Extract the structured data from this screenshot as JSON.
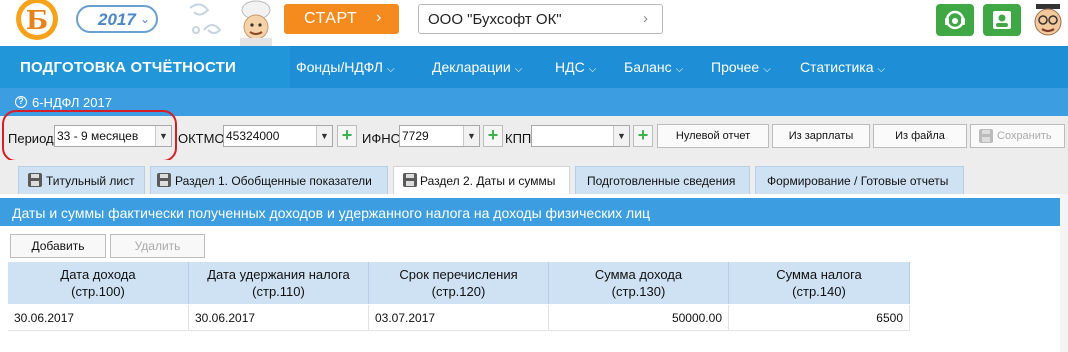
{
  "topbar": {
    "year": "2017",
    "start_label": "СТАРТ",
    "start_arrow": "›",
    "org_name": "ООО \"Бухсофт ОК\"",
    "org_arrow": "›",
    "accent_orange": "#f58a1f",
    "accent_green": "#3fa845"
  },
  "nav": {
    "title": "ПОДГОТОВКА ОТЧЁТНОСТИ",
    "items": [
      {
        "label": "Фонды/НДФЛ"
      },
      {
        "label": "Декларации"
      },
      {
        "label": "НДС"
      },
      {
        "label": "Баланс"
      },
      {
        "label": "Прочее"
      },
      {
        "label": "Статистика"
      }
    ],
    "color": "#1e8fd6"
  },
  "report": {
    "title": "6-НДФЛ 2017"
  },
  "toolbar": {
    "period_label": "Период",
    "period_value": "33 - 9 месяцев",
    "oktmo_label": "ОКТМО",
    "oktmo_value": "45324000",
    "ifns_label": "ИФНС",
    "ifns_value": "7729",
    "kpp_label": "КПП",
    "kpp_value": "",
    "zero_report": "Нулевой отчет",
    "from_salary": "Из зарплаты",
    "from_file": "Из файла",
    "save": "Сохранить"
  },
  "tabs": [
    {
      "label": "Титульный лист"
    },
    {
      "label": "Раздел 1. Обобщенные показатели"
    },
    {
      "label": "Раздел 2. Даты и суммы"
    },
    {
      "label": "Подготовленные сведения"
    },
    {
      "label": "Формирование / Готовые отчеты"
    }
  ],
  "section": {
    "title": "Даты и суммы фактически полученных доходов и удержанного налога на доходы физических лиц",
    "add": "Добавить",
    "delete": "Удалить"
  },
  "table": {
    "headers": [
      {
        "l1": "Дата дохода",
        "l2": "(стр.100)"
      },
      {
        "l1": "Дата удержания налога",
        "l2": "(стр.110)"
      },
      {
        "l1": "Срок перечисления",
        "l2": "(стр.120)"
      },
      {
        "l1": "Сумма дохода",
        "l2": "(стр.130)"
      },
      {
        "l1": "Сумма налога",
        "l2": "(стр.140)"
      }
    ],
    "rows": [
      [
        "30.06.2017",
        "30.06.2017",
        "03.07.2017",
        "50000.00",
        "6500"
      ]
    ]
  }
}
